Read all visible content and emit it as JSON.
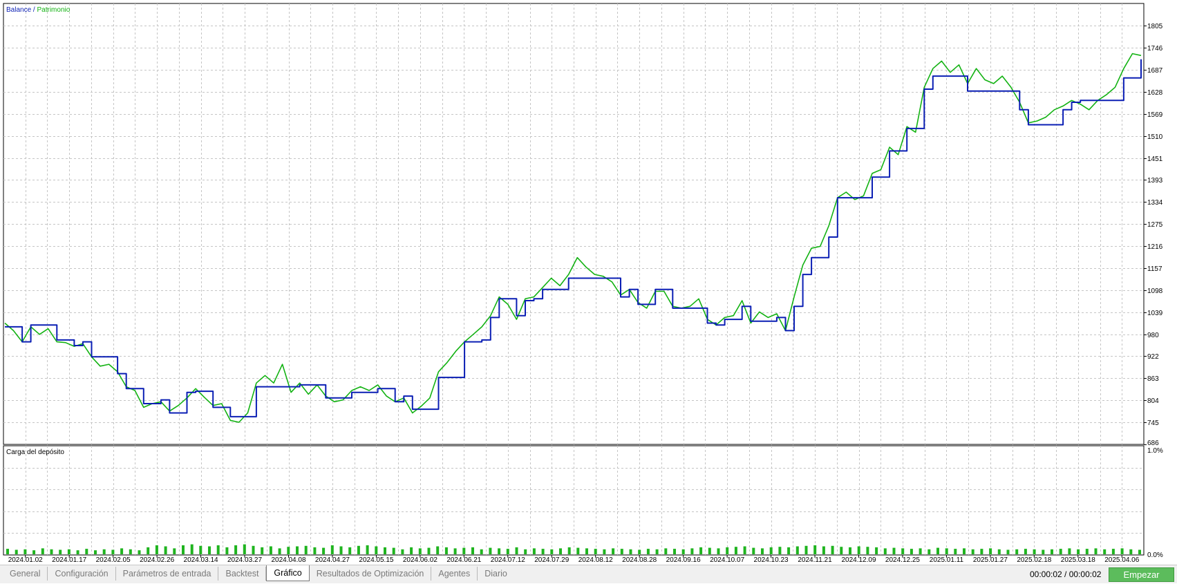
{
  "legend": {
    "balance": "Balance",
    "separator": " / ",
    "equity": "Patrimonio"
  },
  "sub_panel": {
    "title": "Carga del depósito",
    "scale_top": "1.0%",
    "scale_bottom": "0.0%"
  },
  "colors": {
    "balance": "#0a1eb4",
    "equity": "#12b212",
    "deposit_load": "#1fb41f",
    "grid": "#c4c4c4",
    "button": "#5cbc5c"
  },
  "chart_data": {
    "type": "line",
    "series": [
      {
        "name": "Balance",
        "values": [
          1000,
          1000,
          960,
          1005,
          1005,
          1005,
          965,
          965,
          950,
          960,
          920,
          920,
          920,
          875,
          835,
          835,
          795,
          795,
          805,
          770,
          770,
          825,
          828,
          828,
          785,
          785,
          760,
          760,
          760,
          840,
          840,
          840,
          840,
          840,
          845,
          845,
          845,
          810,
          810,
          810,
          825,
          825,
          825,
          835,
          835,
          800,
          815,
          780,
          780,
          780,
          865,
          865,
          865,
          960,
          960,
          965,
          1025,
          1075,
          1075,
          1030,
          1070,
          1075,
          1100,
          1100,
          1100,
          1130,
          1130,
          1130,
          1130,
          1130,
          1130,
          1080,
          1100,
          1060,
          1060,
          1100,
          1100,
          1050,
          1050,
          1050,
          1050,
          1010,
          1005,
          1020,
          1020,
          1055,
          1015,
          1015,
          1015,
          1025,
          990,
          1055,
          1140,
          1185,
          1185,
          1240,
          1345,
          1345,
          1345,
          1345,
          1400,
          1400,
          1470,
          1470,
          1530,
          1530,
          1635,
          1670,
          1670,
          1670,
          1670,
          1630,
          1630,
          1630,
          1630,
          1630,
          1630,
          1580,
          1540,
          1540,
          1540,
          1540,
          1580,
          1600,
          1605,
          1605,
          1605,
          1605,
          1605,
          1665,
          1665,
          1715
        ]
      },
      {
        "name": "Patrimonio",
        "values": [
          1010,
          990,
          960,
          1000,
          980,
          995,
          960,
          958,
          948,
          955,
          920,
          895,
          900,
          880,
          840,
          830,
          785,
          795,
          800,
          775,
          790,
          810,
          835,
          812,
          790,
          795,
          750,
          745,
          770,
          850,
          870,
          850,
          900,
          825,
          850,
          820,
          845,
          815,
          800,
          805,
          830,
          840,
          830,
          845,
          815,
          800,
          810,
          770,
          788,
          810,
          880,
          905,
          935,
          960,
          980,
          1000,
          1030,
          1080,
          1060,
          1020,
          1075,
          1080,
          1105,
          1130,
          1110,
          1140,
          1185,
          1160,
          1140,
          1135,
          1120,
          1085,
          1100,
          1065,
          1050,
          1095,
          1095,
          1055,
          1050,
          1055,
          1075,
          1020,
          1005,
          1025,
          1030,
          1070,
          1010,
          1040,
          1025,
          1035,
          990,
          1080,
          1165,
          1210,
          1215,
          1270,
          1345,
          1360,
          1340,
          1350,
          1410,
          1420,
          1480,
          1460,
          1535,
          1520,
          1640,
          1690,
          1710,
          1680,
          1700,
          1650,
          1690,
          1660,
          1650,
          1670,
          1640,
          1600,
          1545,
          1550,
          1560,
          1580,
          1590,
          1605,
          1595,
          1580,
          1605,
          1620,
          1640,
          1690,
          1730,
          1725
        ]
      }
    ],
    "deposit_load": [
      0.055,
      0.045,
      0.05,
      0.04,
      0.06,
      0.05,
      0.045,
      0.05,
      0.04,
      0.055,
      0.04,
      0.05,
      0.045,
      0.06,
      0.05,
      0.04,
      0.07,
      0.09,
      0.08,
      0.06,
      0.09,
      0.1,
      0.085,
      0.08,
      0.09,
      0.07,
      0.09,
      0.1,
      0.085,
      0.07,
      0.08,
      0.06,
      0.075,
      0.08,
      0.085,
      0.07,
      0.065,
      0.09,
      0.08,
      0.07,
      0.085,
      0.09,
      0.08,
      0.07,
      0.065,
      0.05,
      0.07,
      0.06,
      0.065,
      0.08,
      0.07,
      0.06,
      0.065,
      0.07,
      0.05,
      0.065,
      0.06,
      0.055,
      0.07,
      0.05,
      0.06,
      0.055,
      0.05,
      0.06,
      0.07,
      0.065,
      0.06,
      0.055,
      0.05,
      0.06,
      0.055,
      0.05,
      0.045,
      0.055,
      0.05,
      0.06,
      0.055,
      0.05,
      0.06,
      0.07,
      0.065,
      0.06,
      0.07,
      0.075,
      0.08,
      0.065,
      0.06,
      0.07,
      0.075,
      0.07,
      0.08,
      0.085,
      0.09,
      0.08,
      0.085,
      0.075,
      0.07,
      0.08,
      0.075,
      0.07,
      0.06,
      0.065,
      0.06,
      0.055,
      0.06,
      0.05,
      0.065,
      0.06,
      0.055,
      0.06,
      0.05,
      0.055,
      0.06,
      0.05,
      0.045,
      0.05,
      0.055,
      0.05,
      0.045,
      0.05,
      0.055,
      0.06,
      0.05,
      0.055,
      0.06,
      0.05,
      0.055,
      0.06,
      0.05,
      0.045
    ],
    "y_ticks": [
      "1805",
      "1746",
      "1687",
      "1628",
      "1569",
      "1510",
      "1451",
      "1393",
      "1334",
      "1275",
      "1216",
      "1157",
      "1098",
      "1039",
      "980",
      "922",
      "863",
      "804",
      "745",
      "686"
    ],
    "x_labels": [
      "2024.01.02",
      "2024.01.17",
      "2024.02.05",
      "2024.02.26",
      "2024.03.14",
      "2024.03.27",
      "2024.04.08",
      "2024.04.27",
      "2024.05.15",
      "2024.06.02",
      "2024.06.21",
      "2024.07.12",
      "2024.07.29",
      "2024.08.12",
      "2024.08.28",
      "2024.09.16",
      "2024.10.07",
      "2024.10.23",
      "2024.11.21",
      "2024.12.09",
      "2024.12.25",
      "2025.01.11",
      "2025.01.27",
      "2025.02.18",
      "2025.03.18",
      "2025.04.06"
    ],
    "ylim": [
      686,
      1864
    ],
    "sub_ylim": [
      0,
      1
    ],
    "grid": true,
    "legend_position": "top-left"
  },
  "tabs": [
    {
      "label": "General",
      "active": false
    },
    {
      "label": "Configuración",
      "active": false
    },
    {
      "label": "Parámetros de entrada",
      "active": false
    },
    {
      "label": "Backtest",
      "active": false
    },
    {
      "label": "Gráfico",
      "active": true
    },
    {
      "label": "Resultados de Optimización",
      "active": false
    },
    {
      "label": "Agentes",
      "active": false
    },
    {
      "label": "Diario",
      "active": false
    }
  ],
  "status": {
    "timer": "00:00:02 / 00:00:02"
  },
  "actions": {
    "start_label": "Empezar"
  }
}
